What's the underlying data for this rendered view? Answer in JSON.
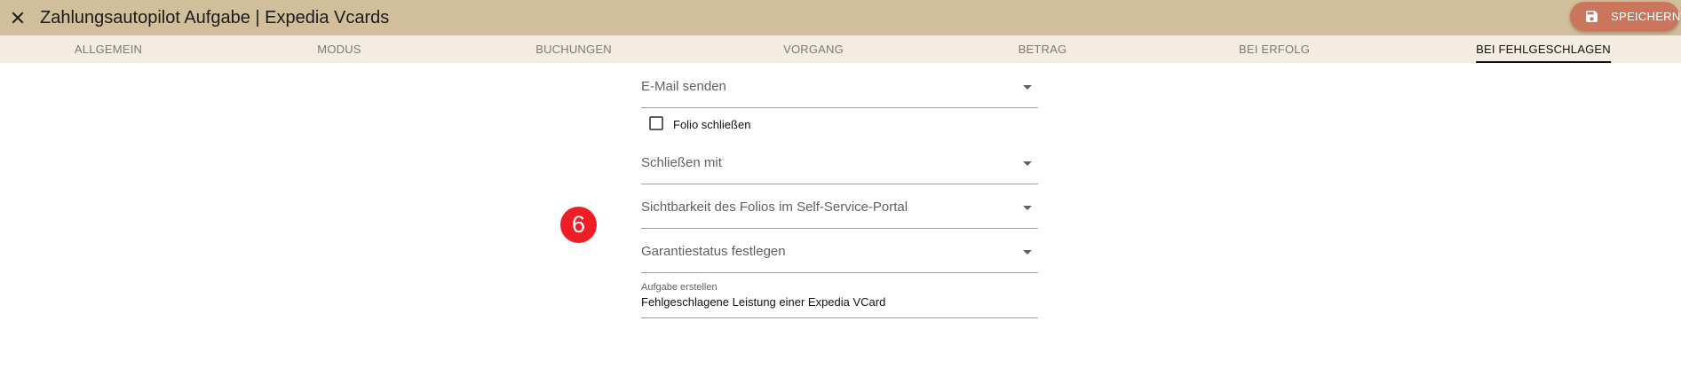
{
  "header": {
    "title": "Zahlungsautopilot Aufgabe | Expedia Vcards",
    "close_icon": "close-icon",
    "save_label": "SPEICHERN",
    "save_icon": "save-icon",
    "background": "#d1bf9b",
    "save_color": "#c9765c"
  },
  "tabs": [
    {
      "label": "ALLGEMEIN",
      "active": false
    },
    {
      "label": "MODUS",
      "active": false
    },
    {
      "label": "BUCHUNGEN",
      "active": false
    },
    {
      "label": "VORGANG",
      "active": false
    },
    {
      "label": "BETRAG",
      "active": false
    },
    {
      "label": "BEI ERFOLG",
      "active": false
    },
    {
      "label": "BEI FEHLGESCHLAGEN",
      "active": true
    }
  ],
  "form": {
    "email_select": {
      "label": "E-Mail senden"
    },
    "close_folio_checkbox": {
      "label": "Folio schließen",
      "checked": false
    },
    "close_with_select": {
      "label": "Schließen mit"
    },
    "visibility_select": {
      "label": "Sichtbarkeit des Folios im Self-Service-Portal"
    },
    "guarantee_select": {
      "label": "Garantiestatus festlegen"
    },
    "create_task_field": {
      "label": "Aufgabe erstellen",
      "value": "Fehlgeschlagene Leistung einer Expedia VCard"
    }
  },
  "step_badge": {
    "number": "6",
    "color": "#ee1e24"
  }
}
